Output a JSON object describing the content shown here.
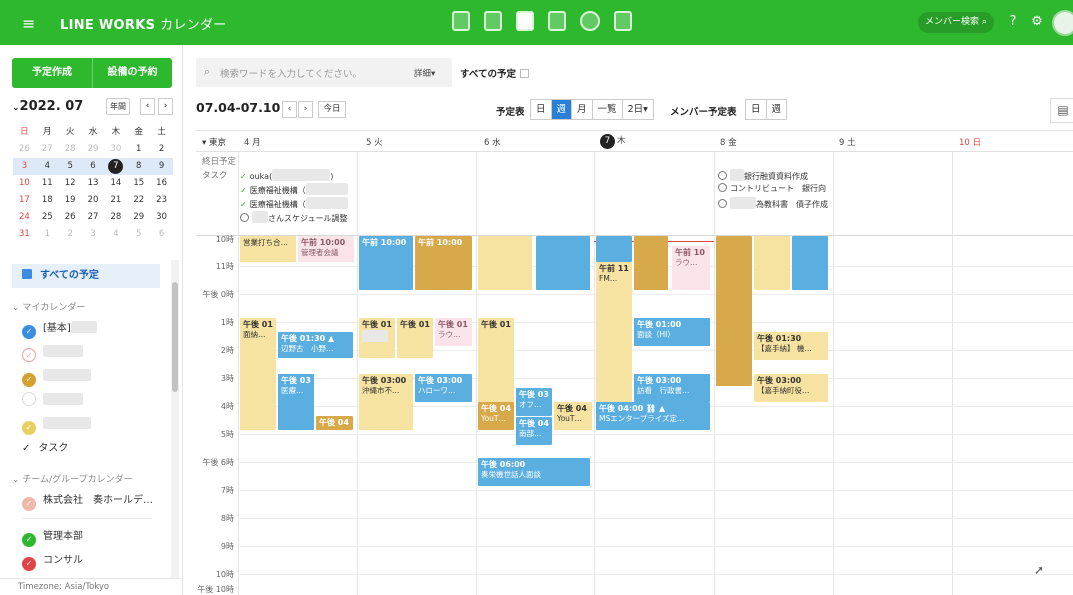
{
  "app": {
    "title": "LINE WORKS",
    "subtitle": "カレンダー",
    "member_search": "メンバー検索",
    "hamburger": "≡",
    "help": "?",
    "settings": "⚙"
  },
  "sidebar": {
    "new_button": "予定作成",
    "facility_button": "設備の予約",
    "month_label": "2022. 07",
    "year_button": "年間",
    "prev": "‹",
    "next": "›",
    "weekdays": [
      "日",
      "月",
      "火",
      "水",
      "木",
      "金",
      "土"
    ],
    "weeks": [
      [
        "26",
        "27",
        "28",
        "29",
        "30",
        "1",
        "2"
      ],
      [
        "3",
        "4",
        "5",
        "6",
        "7",
        "8",
        "9"
      ],
      [
        "10",
        "11",
        "12",
        "13",
        "14",
        "15",
        "16"
      ],
      [
        "17",
        "18",
        "19",
        "20",
        "21",
        "22",
        "23"
      ],
      [
        "24",
        "25",
        "26",
        "27",
        "28",
        "29",
        "30"
      ],
      [
        "31",
        "1",
        "2",
        "3",
        "4",
        "5",
        "6"
      ]
    ],
    "all_schedules": "すべての予定",
    "my_calendars_section": "マイカレンダー",
    "my_basic": "[基本]",
    "task_label": "タスク",
    "team_section": "チーム/グループカレンダー",
    "team_item_1": "株式会社　奏ホールデ…",
    "team_item_2": "管理本部",
    "team_item_3": "コンサル",
    "timezone": "Timezone: Asia/Tokyo",
    "colors": [
      "#3a8de0",
      "#e8a0a0",
      "#d4a030",
      "#ffffff",
      "#e8d060"
    ]
  },
  "toolbar": {
    "search_placeholder": "検索ワードを入力してください。",
    "detail": "詳細▾",
    "all_schedules": "すべての予定",
    "range": "07.04-07.10",
    "prev": "‹",
    "next": "›",
    "today": "今日",
    "schedule_label": "予定表",
    "views": [
      "日",
      "週",
      "月",
      "一覧",
      "2日▾"
    ],
    "member_label": "メンバー予定表",
    "member_views": [
      "日",
      "週"
    ]
  },
  "calendar": {
    "tz_label": "▾ 東京",
    "days": [
      "4 月",
      "5 火",
      "6 水",
      "7",
      "8 金",
      "9 土",
      "10 日"
    ],
    "today_day": "木",
    "allday_label": "終日予定",
    "task_row_label": "タスク",
    "tasks_monday": [
      {
        "mark": "check",
        "text": "ouka("
      },
      {
        "mark": "check",
        "text": "医療福祉機構（"
      },
      {
        "mark": "check",
        "text": "医療福祉機構（"
      },
      {
        "mark": "circle",
        "text": "さんスケジュール調整"
      }
    ],
    "task_paren_close": ")",
    "tasks_friday": [
      {
        "text": "銀行融資資料作成"
      },
      {
        "text": "コントリビュート　銀行向"
      },
      {
        "text": "為教科書　債子作成"
      }
    ],
    "hours": [
      "10時",
      "11時",
      "午後 0時",
      "1時",
      "2時",
      "3時",
      "4時",
      "5時",
      "午後 6時",
      "7時",
      "8時",
      "9時",
      "10時",
      "午後 10時"
    ],
    "events": {
      "mon_a": {
        "t": "",
        "s": "営業打ち合…"
      },
      "mon_b": {
        "t": "午前 10:00",
        "s": "管理者会議"
      },
      "mon_c": {
        "t": "午後 01",
        "s": "面納…"
      },
      "mon_d": {
        "t": "午後 01:30 ▲",
        "s": "辺野古　小野…"
      },
      "mon_e": {
        "t": "午後 03",
        "s": "医療…"
      },
      "mon_f": {
        "t": "午後 04",
        "s": ""
      },
      "tue_a": {
        "t": "午前 10:00",
        "s": ""
      },
      "tue_b": {
        "t": "午前 10:00",
        "s": ""
      },
      "tue_c": {
        "t": "午後 01",
        "s": ""
      },
      "tue_d": {
        "t": "午後 01",
        "s": ""
      },
      "tue_e": {
        "t": "午後 01",
        "s": "ラウ…"
      },
      "tue_f": {
        "t": "午後 03:00",
        "s": "沖縄市不…"
      },
      "tue_g": {
        "t": "午後 03:00",
        "s": "ハローワ…"
      },
      "wed_a": {
        "t": "午後 01",
        "s": ""
      },
      "wed_b": {
        "t": "午後 03",
        "s": "オフ…"
      },
      "wed_c": {
        "t": "午後 04",
        "s": "YouT…"
      },
      "wed_d": {
        "t": "午後 04",
        "s": "南部…"
      },
      "wed_e": {
        "t": "午後 04",
        "s": "YouT…"
      },
      "wed_f": {
        "t": "午後 06:00",
        "s": "奏栄機世話人面談"
      },
      "thu_a": {
        "t": "午前 11",
        "s": "FM…"
      },
      "thu_b": {
        "t": "午前 10",
        "s": "ラウ…"
      },
      "thu_c": {
        "t": "午後 01:00",
        "s": "面談（HI）"
      },
      "thu_d": {
        "t": "午後 03:00",
        "s": "訪看　行政書…"
      },
      "thu_e": {
        "t": "午後 04:00 ⛓ ▲",
        "s": "MSエンタープライズ定…"
      },
      "fri_a": {
        "t": "午後 01:30",
        "s": "【嘉手納】 機…"
      },
      "fri_b": {
        "t": "午後 03:00",
        "s": "【嘉手納町役…"
      }
    }
  }
}
